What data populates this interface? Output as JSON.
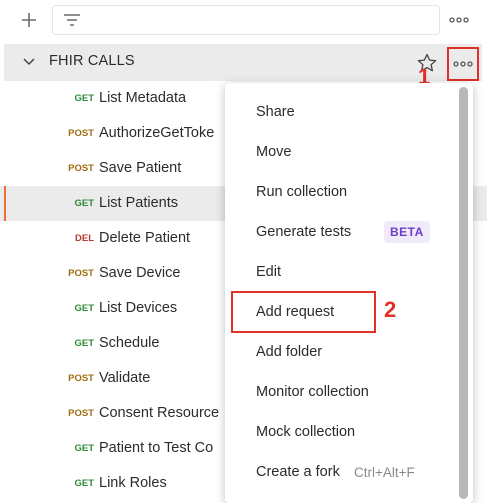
{
  "toolbar": {
    "add_icon": "plus-icon",
    "filter_icon": "filter-icon",
    "more_icon": "more-horizontal-icon"
  },
  "collection": {
    "name": "FHIR CALLS",
    "star_icon": "star-outline-icon",
    "more_icon": "more-horizontal-icon"
  },
  "annotations": {
    "step1": "1",
    "step2": "2",
    "color": "#e0302a"
  },
  "requests": [
    {
      "method": "GET",
      "name": "List Metadata"
    },
    {
      "method": "POST",
      "name": "AuthorizeGetToke"
    },
    {
      "method": "POST",
      "name": "Save Patient"
    },
    {
      "method": "GET",
      "name": "List Patients",
      "selected": true
    },
    {
      "method": "DEL",
      "name": "Delete Patient"
    },
    {
      "method": "POST",
      "name": "Save Device"
    },
    {
      "method": "GET",
      "name": "List Devices"
    },
    {
      "method": "GET",
      "name": "Schedule"
    },
    {
      "method": "POST",
      "name": "Validate"
    },
    {
      "method": "POST",
      "name": "Consent Resource"
    },
    {
      "method": "GET",
      "name": "Patient to Test Co"
    },
    {
      "method": "GET",
      "name": "Link Roles"
    }
  ],
  "menu": {
    "items": [
      {
        "label": "Share"
      },
      {
        "label": "Move"
      },
      {
        "label": "Run collection"
      },
      {
        "label": "Generate tests",
        "badge": "BETA"
      },
      {
        "label": "Edit"
      },
      {
        "label": "Add request",
        "highlighted": true
      },
      {
        "label": "Add folder"
      },
      {
        "label": "Monitor collection"
      },
      {
        "label": "Mock collection"
      },
      {
        "label": "Create a fork",
        "shortcut": "Ctrl+Alt+F"
      }
    ]
  }
}
